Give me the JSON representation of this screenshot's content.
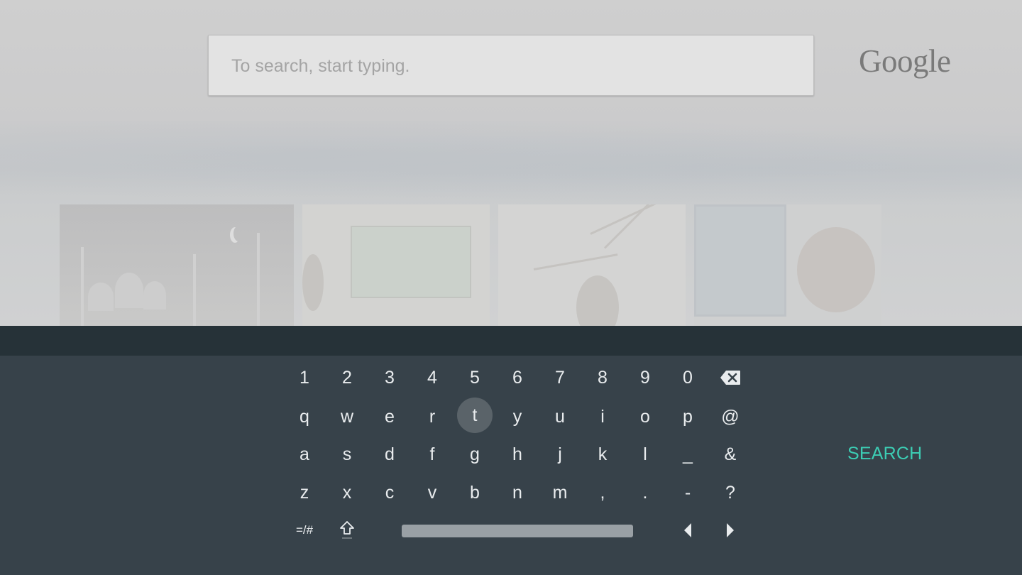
{
  "search": {
    "placeholder": "To search, start typing.",
    "value": ""
  },
  "branding": {
    "logo_text": "Google"
  },
  "keyboard": {
    "rows": {
      "numbers": [
        "1",
        "2",
        "3",
        "4",
        "5",
        "6",
        "7",
        "8",
        "9",
        "0"
      ],
      "row1": [
        "q",
        "w",
        "e",
        "r",
        "t",
        "y",
        "u",
        "i",
        "o",
        "p",
        "@"
      ],
      "row2": [
        "a",
        "s",
        "d",
        "f",
        "g",
        "h",
        "j",
        "k",
        "l",
        "_",
        "&"
      ],
      "row3": [
        "z",
        "x",
        "c",
        "v",
        "b",
        "n",
        "m",
        ",",
        ".",
        "-",
        "?"
      ],
      "bottom": [
        "=/#"
      ]
    },
    "focused_key": "t",
    "search_label": "SEARCH",
    "icons": {
      "backspace": "backspace-icon",
      "shift": "shift-icon",
      "left": "arrow-left-icon",
      "right": "arrow-right-icon"
    }
  },
  "colors": {
    "keyboard_bg": "#37424a",
    "keyboard_strip": "#263238",
    "accent": "#3ccdb4",
    "key_text": "#e9ecee",
    "focus_bg": "#5a6369"
  }
}
